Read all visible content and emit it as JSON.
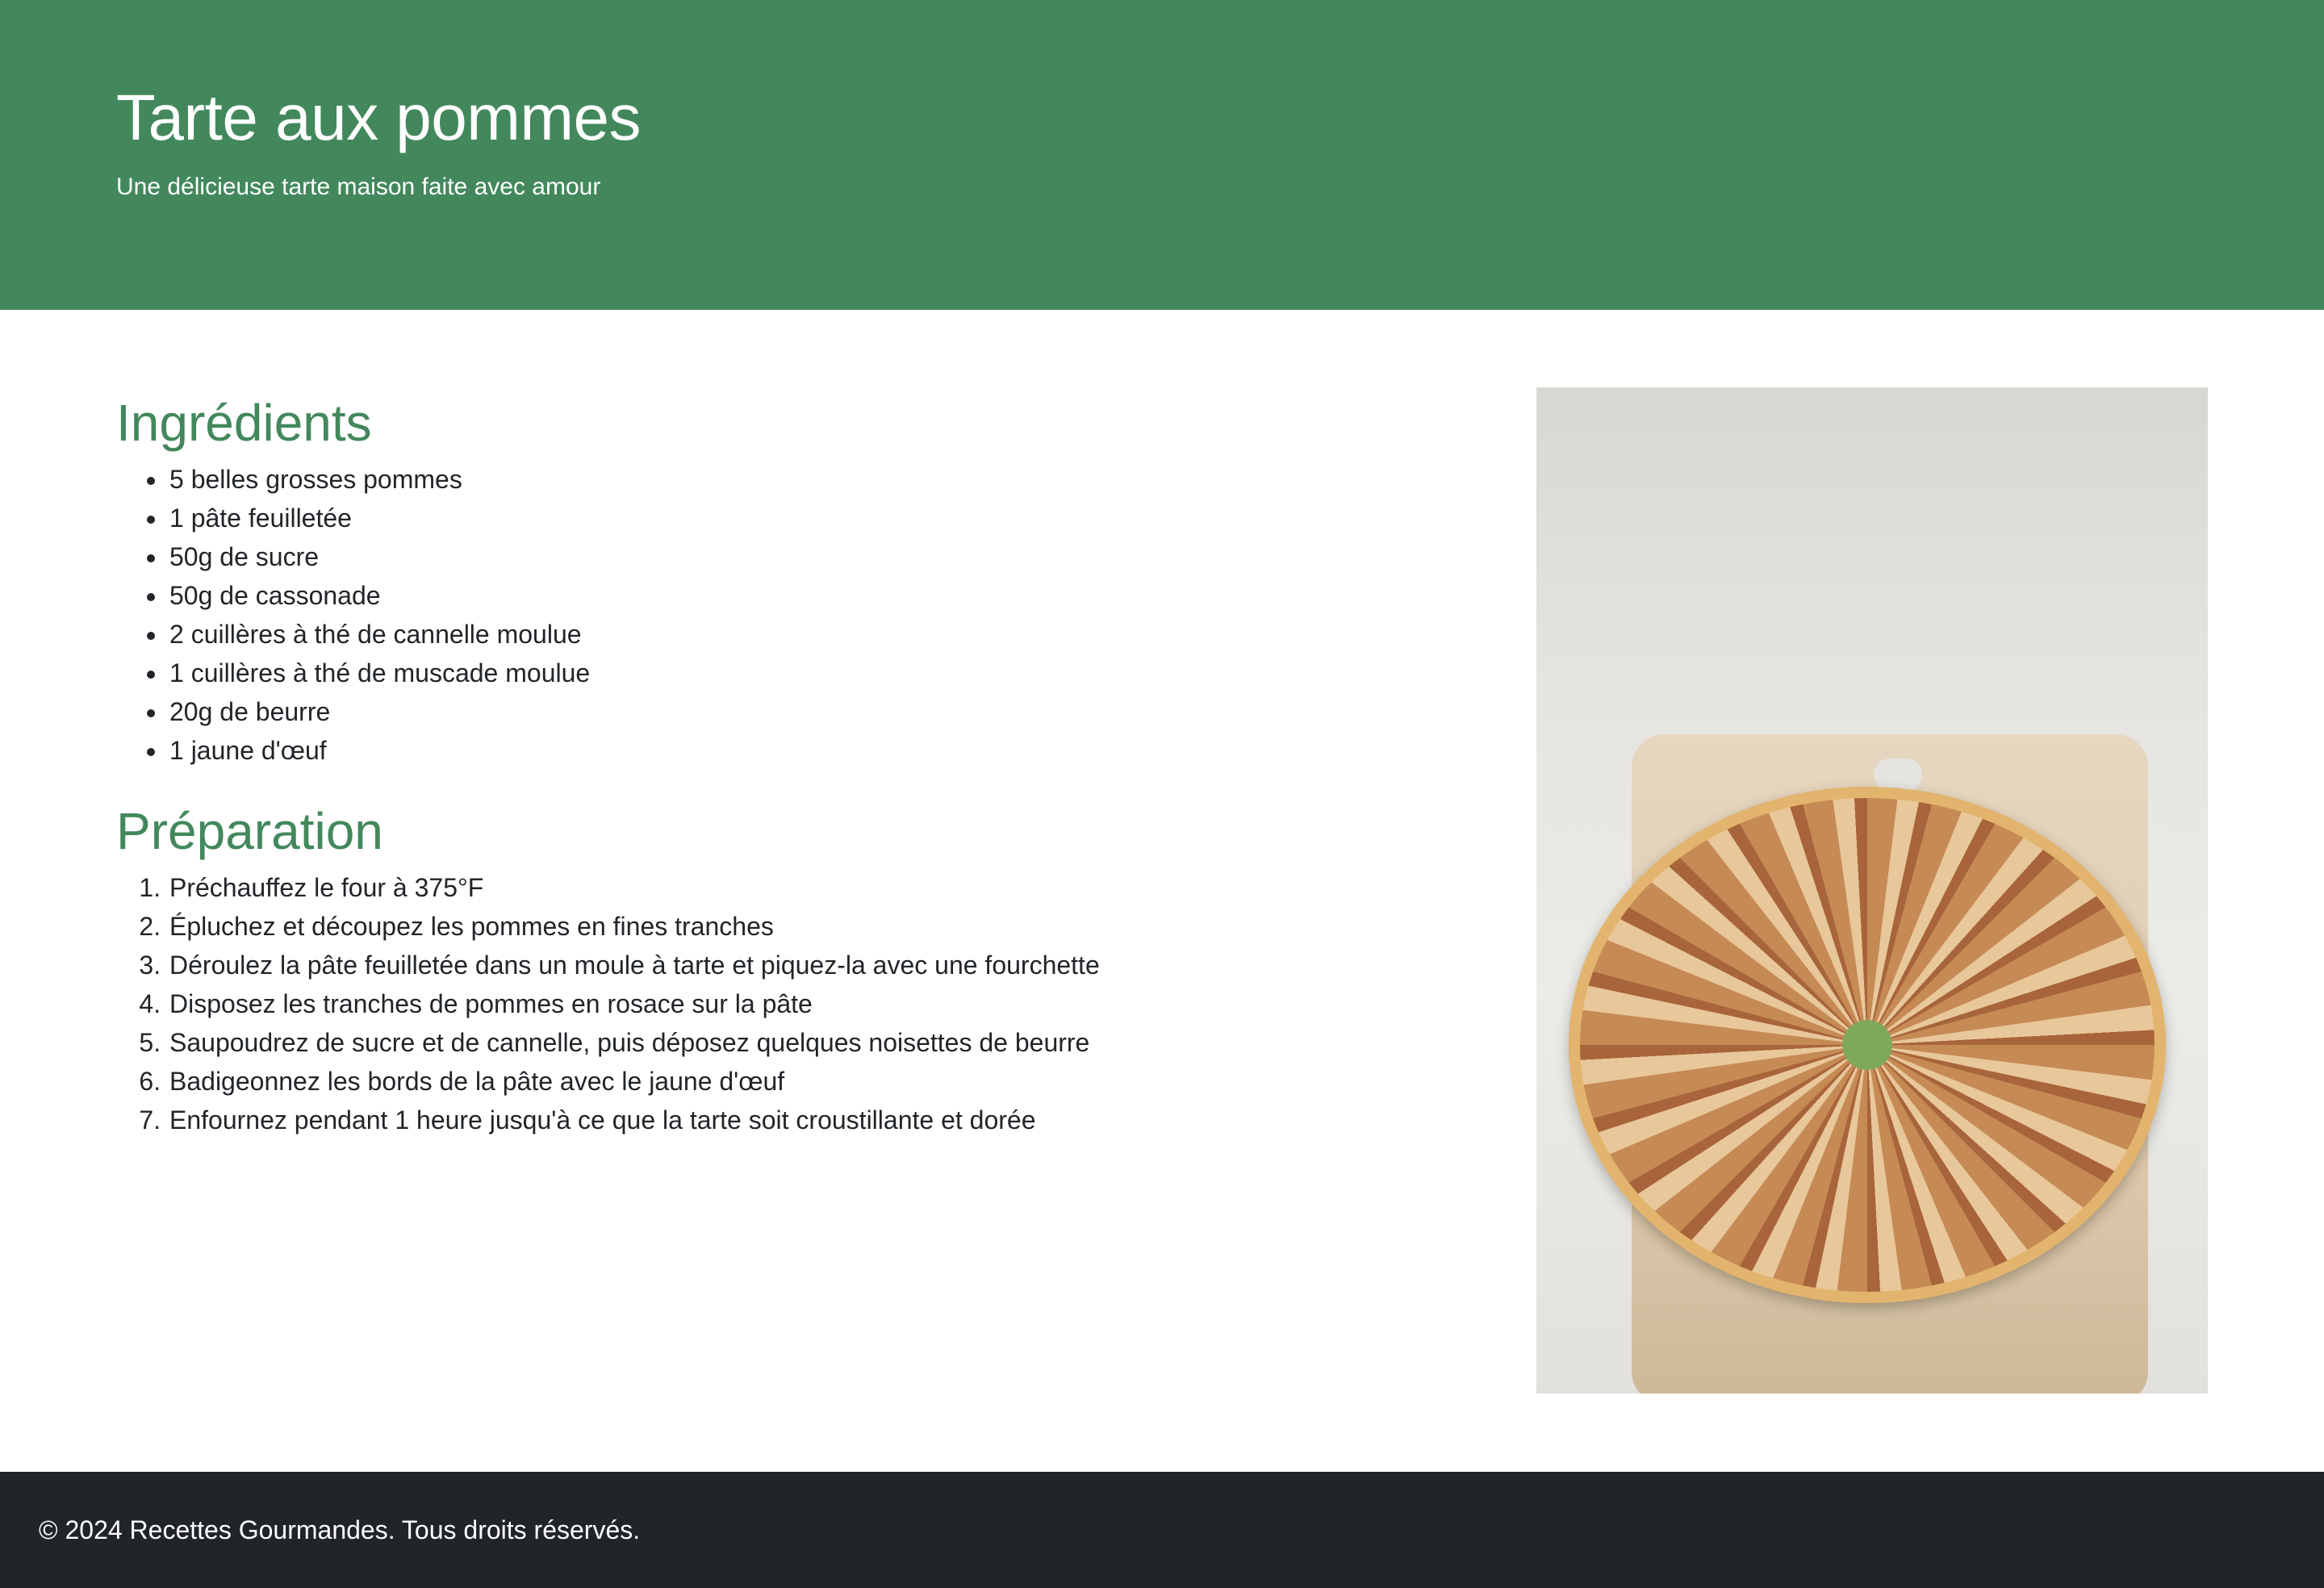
{
  "header": {
    "title": "Tarte aux pommes",
    "subtitle": "Une délicieuse tarte maison faite avec amour"
  },
  "colors": {
    "accent": "#42885c",
    "footer_bg": "#212529"
  },
  "ingredients": {
    "heading": "Ingrédients",
    "items": [
      "5 belles grosses pommes",
      "1 pâte feuilletée",
      "50g de sucre",
      "50g de cassonade",
      "2 cuillères à thé de cannelle moulue",
      "1 cuillères à thé de muscade moulue",
      "20g de beurre",
      "1 jaune d'œuf"
    ]
  },
  "preparation": {
    "heading": "Préparation",
    "steps": [
      "Préchauffez le four à 375°F",
      "Épluchez et découpez les pommes en fines tranches",
      "Déroulez la pâte feuilletée dans un moule à tarte et piquez-la avec une fourchette",
      "Disposez les tranches de pommes en rosace sur la pâte",
      "Saupoudrez de sucre et de cannelle, puis déposez quelques noisettes de beurre",
      "Badigeonnez les bords de la pâte avec le jaune d'œuf",
      "Enfournez pendant 1 heure jusqu'à ce que la tarte soit croustillante et dorée"
    ]
  },
  "footer": {
    "text": "© 2024 Recettes Gourmandes. Tous droits réservés."
  }
}
